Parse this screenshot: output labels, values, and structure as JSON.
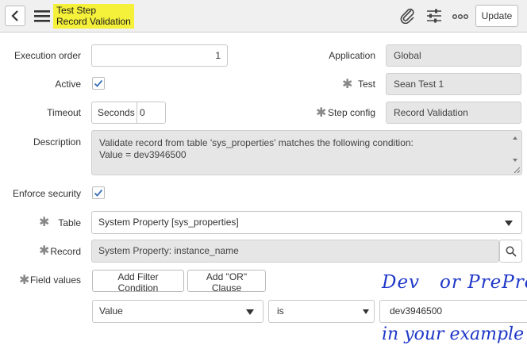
{
  "header": {
    "title_line1": "Test Step",
    "title_line2": "Record Validation",
    "update_label": "Update",
    "icons": [
      "chevron-left-icon",
      "hamburger-menu-icon",
      "paperclip-icon",
      "sliders-icon",
      "more-icon"
    ]
  },
  "form": {
    "execution_order": {
      "label": "Execution order",
      "value": "1"
    },
    "application": {
      "label": "Application",
      "value": "Global"
    },
    "active": {
      "label": "Active",
      "checked": true
    },
    "test": {
      "label": "Test",
      "value": "Sean Test 1"
    },
    "timeout": {
      "label": "Timeout",
      "unit": "Seconds",
      "value": "0"
    },
    "step_config": {
      "label": "Step config",
      "value": "Record Validation"
    },
    "description": {
      "label": "Description",
      "line1": "Validate record from table 'sys_properties' matches the following condition:",
      "line2": "Value = dev3946500"
    },
    "enforce_security": {
      "label": "Enforce security",
      "checked": true
    },
    "table": {
      "label": "Table",
      "value": "System Property [sys_properties]"
    },
    "record": {
      "label": "Record",
      "value": "System Property: instance_name"
    },
    "field_values": {
      "label": "Field values",
      "add_filter_label": "Add Filter Condition",
      "add_or_label": "Add \"OR\" Clause",
      "condition": {
        "field": "Value",
        "operator": "is",
        "value": "dev3946500"
      }
    }
  },
  "annotation": {
    "line1": "Dev   or PreProd",
    "line2": "in your example"
  },
  "colors": {
    "highlight": "#f5f03a",
    "check": "#3a6fb5",
    "handwriting": "#1f38c8",
    "readonly_bg": "#e6e6e6"
  }
}
